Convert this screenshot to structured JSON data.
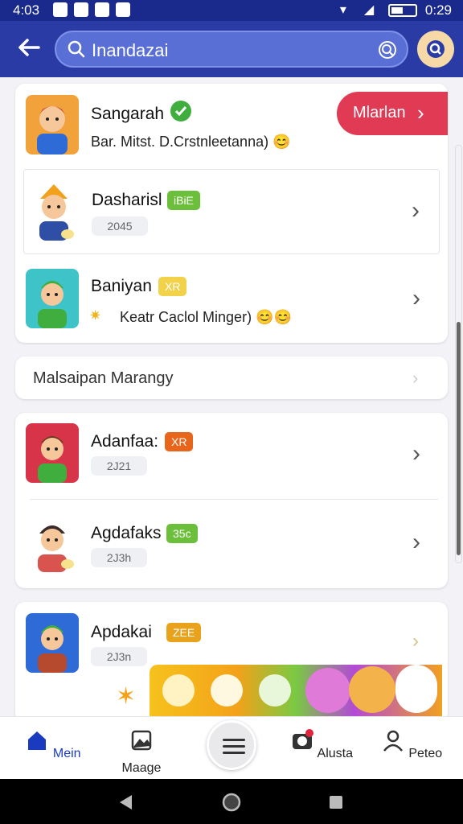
{
  "status_bar": {
    "time": "4:03",
    "clock": "0:29"
  },
  "header": {
    "search_text": "Inandazai"
  },
  "card1": {
    "rows": [
      {
        "name": "Sangarah",
        "subtitle": "Bar. Mitst. D.Crstnleetanna) 😊",
        "action_label": "Mlarlan"
      },
      {
        "name": "Dasharisl",
        "badge": "iBiE",
        "pill": "2045"
      },
      {
        "name": "Baniyan",
        "badge": "XR",
        "subtitle": "Keatr Caclol Minger) 😊😊"
      }
    ]
  },
  "section": {
    "label": "Malsaipan Marangy"
  },
  "card2": {
    "rows": [
      {
        "name": "Adanfaa:",
        "badge": "XR",
        "pill": "2J21"
      },
      {
        "name": "Agdafaks",
        "badge": "35c",
        "pill": "2J3h"
      }
    ]
  },
  "card3": {
    "rows": [
      {
        "name": "Apdakai",
        "badge": "ZEE",
        "pill": "2J3n"
      }
    ]
  },
  "bottom_nav": {
    "items": [
      {
        "label": "Mein"
      },
      {
        "label": "Maage"
      },
      {
        "label": "Alusta"
      },
      {
        "label": "Peteo"
      }
    ]
  },
  "colors": {
    "header": "#2a3ba6",
    "action_button": "#e03a55",
    "badge_green": "#6cbf3a",
    "badge_yellow": "#f1c40f",
    "badge_orange": "#e8651c",
    "active_nav": "#1a3bbf"
  }
}
